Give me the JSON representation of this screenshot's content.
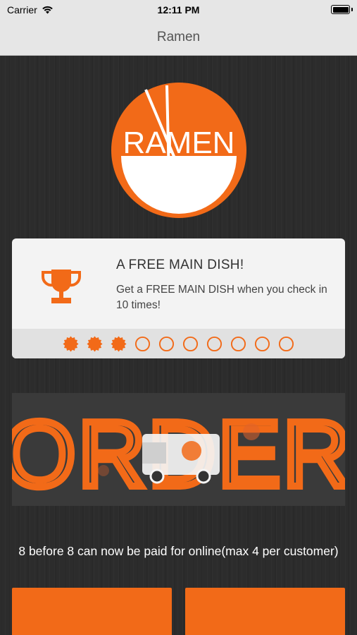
{
  "status_bar": {
    "carrier": "Carrier",
    "time": "12:11 PM"
  },
  "nav": {
    "title": "Ramen"
  },
  "logo": {
    "text": "RAMEN"
  },
  "loyalty_card": {
    "icon": "trophy-icon",
    "title": "A FREE MAIN DISH!",
    "description": "Get a FREE MAIN DISH when you check in 10 times!",
    "stamps_total": 10,
    "stamps_filled": 3
  },
  "order_banner": {
    "text": "ORDER"
  },
  "notice": {
    "text": "8 before 8 can now be paid for online(max 4 per customer)"
  },
  "colors": {
    "accent": "#f26a18",
    "background": "#2c2c2c",
    "nav_background": "#e6e6e6",
    "card_background": "#f3f3f3"
  }
}
